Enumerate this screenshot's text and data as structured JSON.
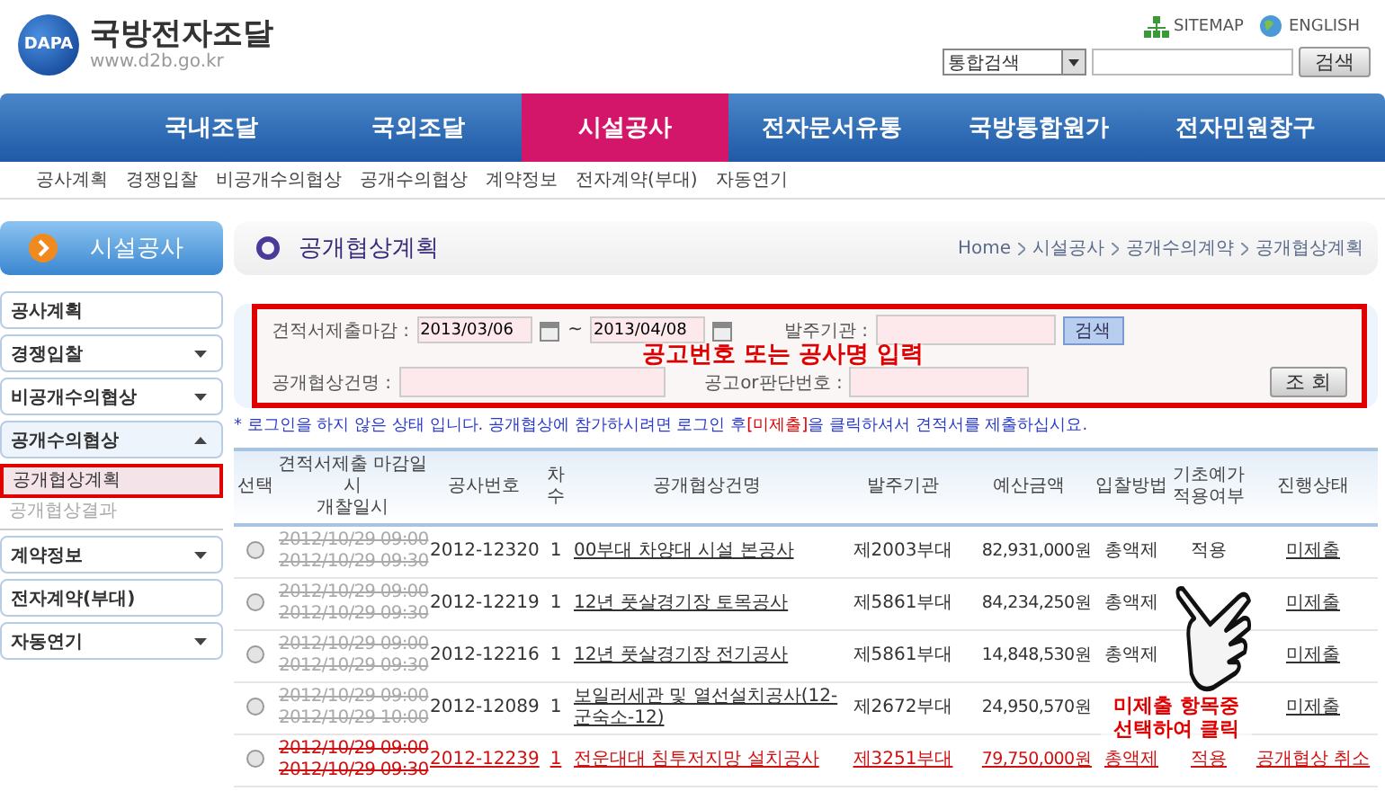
{
  "header": {
    "logo_mark": "DAPA",
    "site_name": "국방전자조달",
    "site_url": "www.d2b.go.kr",
    "links": [
      "SITEMAP",
      "ENGLISH"
    ],
    "search_scope": "통합검색",
    "search_button": "검색"
  },
  "nav": [
    {
      "label": "국내조달",
      "selected": false
    },
    {
      "label": "국외조달",
      "selected": false
    },
    {
      "label": "시설공사",
      "selected": true
    },
    {
      "label": "전자문서유통",
      "selected": false
    },
    {
      "label": "국방통합원가",
      "selected": false
    },
    {
      "label": "전자민원창구",
      "selected": false
    }
  ],
  "subnav": [
    "공사계획",
    "경쟁입찰",
    "비공개수의협상",
    "공개수의협상",
    "계약정보",
    "전자계약(부대)",
    "자동연기"
  ],
  "sidebar": {
    "title": "시설공사",
    "items": [
      {
        "label": "공사계획",
        "kind": "link"
      },
      {
        "label": "경쟁입찰",
        "kind": "menu",
        "expanded": false
      },
      {
        "label": "비공개수의협상",
        "kind": "menu",
        "expanded": false
      },
      {
        "label": "공개수의협상",
        "kind": "menu",
        "expanded": true,
        "children": [
          {
            "label": "공개협상계획",
            "selected": true
          },
          {
            "label": "공개협상결과",
            "selected": false
          }
        ]
      },
      {
        "label": "계약정보",
        "kind": "menu",
        "expanded": false
      },
      {
        "label": "전자계약(부대)",
        "kind": "link"
      },
      {
        "label": "자동연기",
        "kind": "menu",
        "expanded": false
      }
    ]
  },
  "page_title": "공개협상계획",
  "breadcrumb": [
    "Home",
    "시설공사",
    "공개수의계약",
    "공개협상계획"
  ],
  "search_form": {
    "deadline_label": "견적서제출마감 :",
    "date_from": "2013/03/06",
    "separator": "~",
    "date_to": "2013/04/08",
    "agency_label": "발주기관 :",
    "search_button": "검색",
    "name_label": "공개협상건명 :",
    "number_label": "공고or판단번호 :",
    "query_button": "조 회"
  },
  "notice": {
    "before": "* 로그인을 하지 않은 상태 입니다. 공개협상에 참가하시려면 로그인 후",
    "highlight": "[미제출]",
    "after": "을 클릭하셔서 견적서를 제출하십시요."
  },
  "table": {
    "columns": [
      "선택",
      [
        "견적서제출 마감일시",
        "개찰일시"
      ],
      "공사번호",
      "차수",
      "공개협상건명",
      "발주기관",
      "예산금액",
      "입찰방법",
      "기초예가 적용여부",
      "진행상태"
    ],
    "rows": [
      {
        "cancelled": false,
        "selected": false,
        "deadline": "2012/10/29 09:00",
        "opening": "2012/10/29 09:30",
        "number": "2012-12320",
        "round": "1",
        "name": "00부대 차양대 시설 본공사",
        "agency": "제2003부대",
        "budget": "82,931,000원",
        "method": "총액제",
        "basis": "적용",
        "status": "미제출"
      },
      {
        "cancelled": false,
        "selected": false,
        "deadline": "2012/10/29 09:00",
        "opening": "2012/10/29 09:30",
        "number": "2012-12219",
        "round": "1",
        "name": "12년 풋살경기장 토목공사",
        "agency": "제5861부대",
        "budget": "84,234,250원",
        "method": "총액제",
        "status": "미제출"
      },
      {
        "cancelled": false,
        "selected": false,
        "deadline": "2012/10/29 09:00",
        "opening": "2012/10/29 09:30",
        "number": "2012-12216",
        "round": "1",
        "name": "12년 풋살경기장 전기공사",
        "agency": "제5861부대",
        "budget": "14,848,530원",
        "method": "총액제",
        "status": "미제출"
      },
      {
        "cancelled": false,
        "selected": false,
        "deadline": "2012/10/29 09:00",
        "opening": "2012/10/29 10:00",
        "number": "2012-12089",
        "round": "1",
        "name": "보일러세관 및 열선설치공사(12-군숙소-12)",
        "agency": "제2672부대",
        "budget": "24,950,570원",
        "status": "미제출"
      },
      {
        "cancelled": true,
        "selected": false,
        "deadline": "2012/10/29 09:00",
        "opening": "2012/10/29 09:30",
        "number": "2012-12239",
        "round": "1",
        "name": "전운대대 침투저지망 설치공사",
        "agency": "제3251부대",
        "budget": "79,750,000원",
        "method": "총액제",
        "basis": "적용",
        "status": "공개협상 취소"
      }
    ]
  },
  "annotations": [
    {
      "text": "공고번호 또는 공사명 입력"
    },
    {
      "text": "미제출 항목중 선택하여 클릭"
    }
  ]
}
